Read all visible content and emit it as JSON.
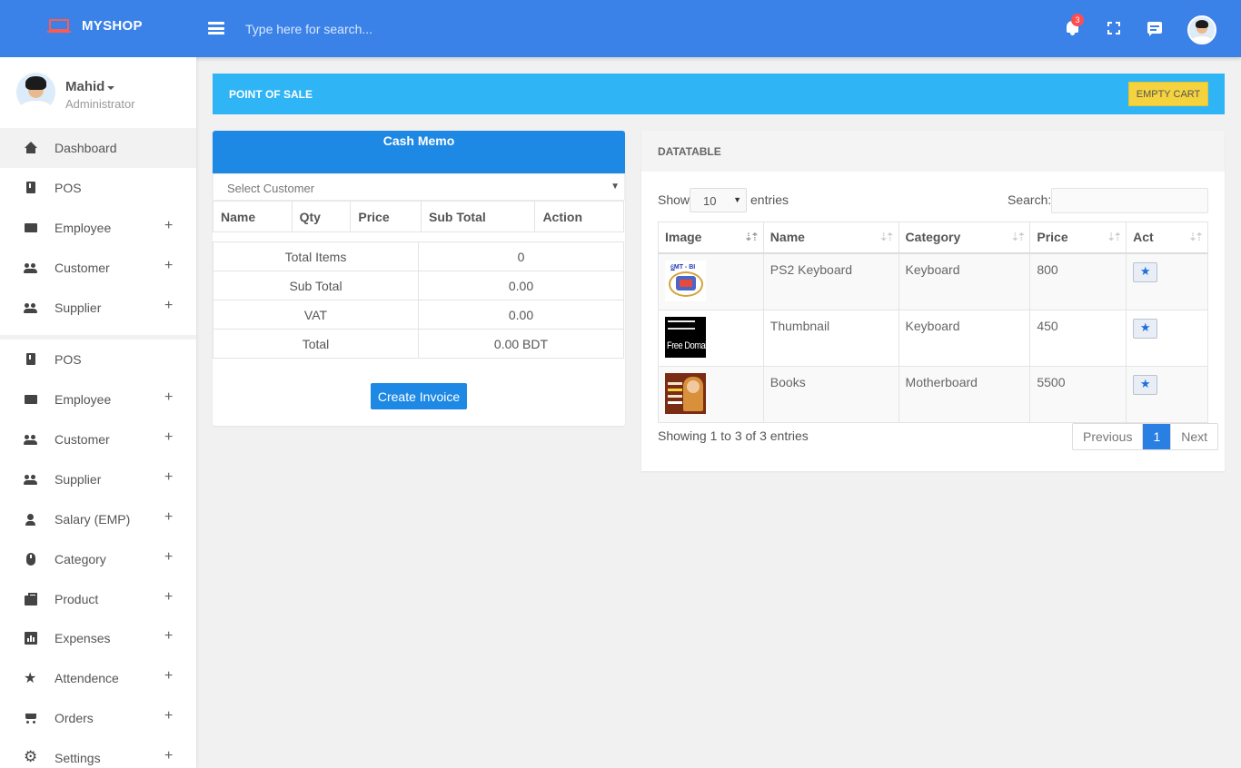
{
  "brand": {
    "name": "MYSHOP"
  },
  "topbar": {
    "search_placeholder": "Type here for search...",
    "notification_count": "3"
  },
  "user": {
    "name": "Mahid",
    "role": "Administrator"
  },
  "sidebar": {
    "group1": [
      {
        "label": "Dashboard",
        "icon": "home-icon"
      },
      {
        "label": "POS",
        "icon": "book-icon"
      },
      {
        "label": "Employee",
        "icon": "mail-icon",
        "plus": "+"
      },
      {
        "label": "Customer",
        "icon": "people-icon",
        "plus": "+"
      },
      {
        "label": "Supplier",
        "icon": "people-icon",
        "plus": "+"
      }
    ],
    "group2": [
      {
        "label": "POS",
        "icon": "book-icon"
      },
      {
        "label": "Employee",
        "icon": "mail-icon",
        "plus": "+"
      },
      {
        "label": "Customer",
        "icon": "people-icon",
        "plus": "+"
      },
      {
        "label": "Supplier",
        "icon": "people-icon",
        "plus": "+"
      },
      {
        "label": "Salary (EMP)",
        "icon": "person-icon",
        "plus": "+"
      },
      {
        "label": "Category",
        "icon": "mouse-icon",
        "plus": "+"
      },
      {
        "label": "Product",
        "icon": "product-icon",
        "plus": "+"
      },
      {
        "label": "Expenses",
        "icon": "chart-icon",
        "plus": "+"
      },
      {
        "label": "Attendence",
        "icon": "star-icon",
        "plus": "+"
      },
      {
        "label": "Orders",
        "icon": "cart-icon",
        "plus": "+"
      },
      {
        "label": "Settings",
        "icon": "gear-icon",
        "plus": "+"
      }
    ]
  },
  "pos": {
    "title": "POINT OF SALE",
    "empty_cart": "EMPTY CART"
  },
  "memo": {
    "title": "Cash Memo",
    "select_customer": "Select Customer",
    "columns": [
      "Name",
      "Qty",
      "Price",
      "Sub Total",
      "Action"
    ],
    "totals": [
      {
        "label": "Total Items",
        "value": "0"
      },
      {
        "label": "Sub Total",
        "value": "0.00"
      },
      {
        "label": "VAT",
        "value": "0.00"
      },
      {
        "label": "Total",
        "value": "0.00 BDT"
      }
    ],
    "create_invoice": "Create Invoice"
  },
  "datatable": {
    "title": "DATATABLE",
    "show_label": "Show",
    "entries_value": "10",
    "entries_label": "entries",
    "search_label": "Search:",
    "columns": [
      "Image",
      "Name",
      "Category",
      "Price",
      "Act"
    ],
    "rows": [
      {
        "name": "PS2 Keyboard",
        "category": "Keyboard",
        "price": "800",
        "image_text": "6ৣMT - BI"
      },
      {
        "name": "Thumbnail",
        "category": "Keyboard",
        "price": "450",
        "image_text": "Free Domain"
      },
      {
        "name": "Books",
        "category": "Motherboard",
        "price": "5500",
        "image_text": ""
      }
    ],
    "info": "Showing 1 to 3 of 3 entries",
    "pagination": {
      "previous": "Previous",
      "current": "1",
      "next": "Next"
    }
  },
  "colors": {
    "topbar": "#3b82e8",
    "pos_bar": "#2fb4f5",
    "memo_header": "#1e88e5",
    "empty_cart": "#f5d33f",
    "badge": "#ff4d4f"
  }
}
